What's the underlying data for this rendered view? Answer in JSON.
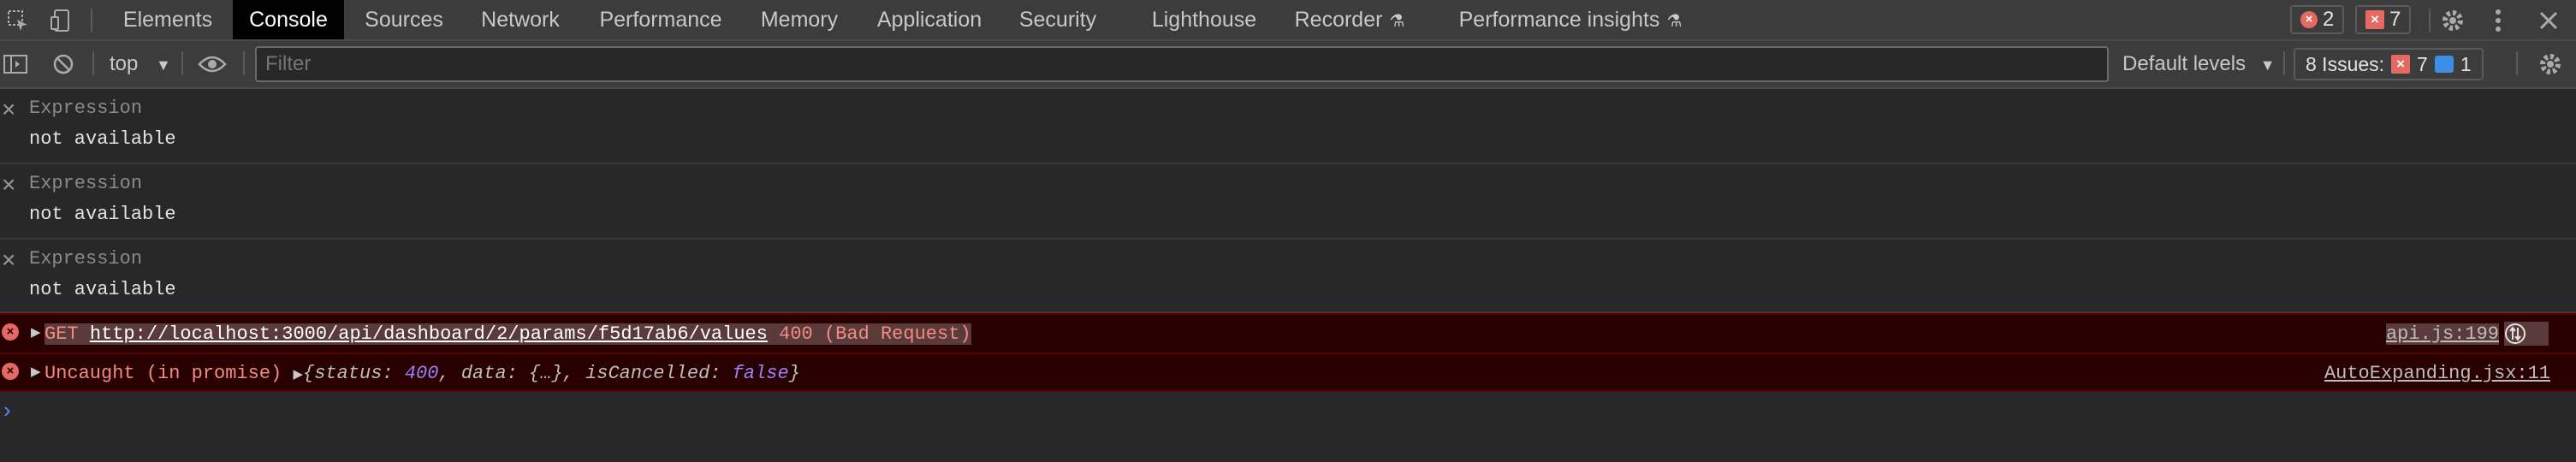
{
  "tabs": [
    "Elements",
    "Console",
    "Sources",
    "Network",
    "Performance",
    "Memory",
    "Application",
    "Security",
    "Lighthouse",
    "Recorder",
    "Performance insights"
  ],
  "tab_icons": [
    "inspect-icon",
    "device-toggle-icon"
  ],
  "beta_icon": "flask-icon",
  "active_tab": "Console",
  "error_badge_count": "2",
  "issue_badge_count": "7",
  "toolbar": {
    "context": "top",
    "filter_placeholder": "Filter",
    "levels": "Default levels",
    "issues_label": "8 Issues:",
    "issues_errors": "7",
    "issues_info": "1"
  },
  "expressions": [
    {
      "label": "Expression",
      "value": "not available"
    },
    {
      "label": "Expression",
      "value": "not available"
    },
    {
      "label": "Expression",
      "value": "not available"
    }
  ],
  "errors": {
    "request": {
      "method": "GET",
      "url": "http://localhost:3000/api/dashboard/2/params/f5d17ab6/values",
      "status": "400 (Bad Request)",
      "source": "api.js:199"
    },
    "promise": {
      "prefix": "Uncaught (in promise)",
      "obj_open": "{status: ",
      "status": "400",
      "mid": ", data: {…}, isCancelled: ",
      "cancelled": "false",
      "close": "}",
      "source": "AutoExpanding.jsx:11"
    }
  },
  "colors": {
    "error": "#e46962",
    "error_bg": "#290000",
    "accent": "#4e8cff"
  }
}
